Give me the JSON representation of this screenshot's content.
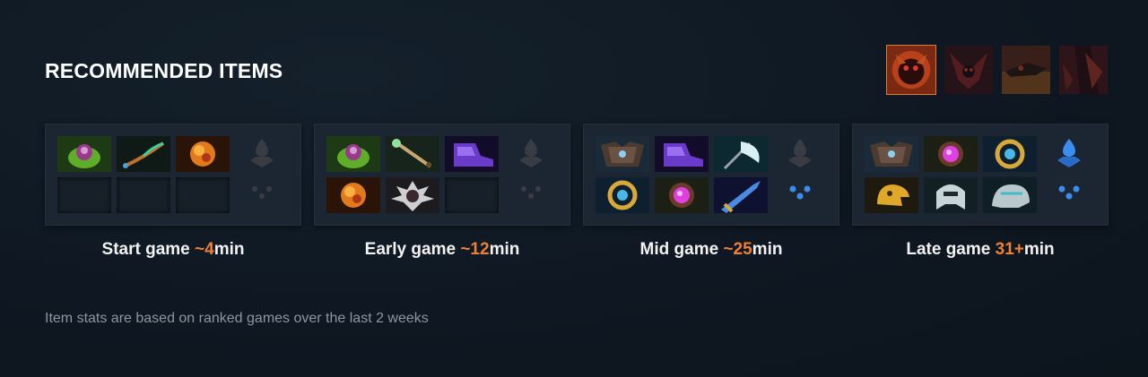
{
  "section_title": "RECOMMENDED ITEMS",
  "hero_tabs": [
    {
      "name": "hero-portrait-1",
      "selected": true
    },
    {
      "name": "hero-portrait-2",
      "selected": false
    },
    {
      "name": "hero-portrait-3",
      "selected": false
    },
    {
      "name": "hero-portrait-4",
      "selected": false
    }
  ],
  "phases": [
    {
      "label_prefix": "Start game",
      "time_value": "~4",
      "time_unit": "min",
      "items": [
        "green-potion-icon",
        "tango-branch-icon",
        "orange-orb-icon",
        "empty",
        "empty",
        "empty"
      ],
      "neutral_active": false
    },
    {
      "label_prefix": "Early game",
      "time_value": "~12",
      "time_unit": "min",
      "items": [
        "green-potion-icon",
        "magic-wand-icon",
        "purple-boots-icon",
        "orange-orb-icon",
        "spiked-helm-icon",
        "empty"
      ],
      "neutral_active": false
    },
    {
      "label_prefix": "Mid game",
      "time_value": "~25",
      "time_unit": "min",
      "items": [
        "armored-vest-icon",
        "purple-boots-icon",
        "ice-axe-icon",
        "golden-ring-icon",
        "pink-orb-icon",
        "blue-blade-icon"
      ],
      "neutral_active": true
    },
    {
      "label_prefix": "Late game",
      "time_value": "31+",
      "time_unit": "min",
      "items": [
        "armored-vest-icon",
        "pink-orb-icon",
        "golden-ring-icon",
        "golden-helm-icon",
        "silver-helm-icon",
        "frost-helm-icon"
      ],
      "neutral_active": true
    }
  ],
  "footnote": "Item stats are based on ranked games over the last 2 weeks",
  "colors": {
    "accent": "#ee7f35",
    "panel": "#1c2632",
    "background": "#0f1822"
  }
}
